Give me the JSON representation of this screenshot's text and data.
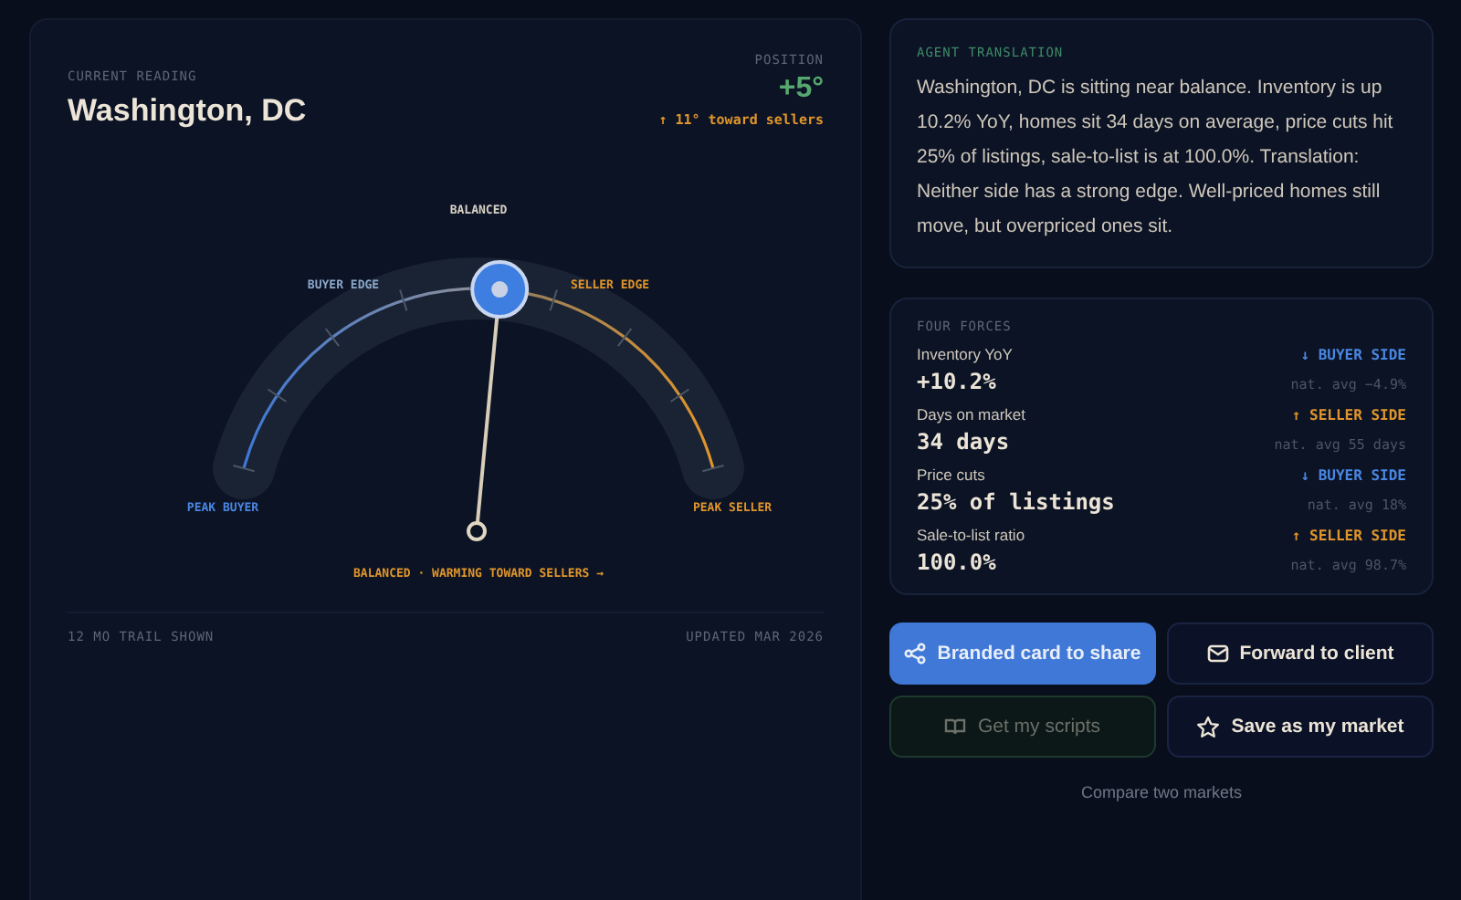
{
  "reading": {
    "label": "CURRENT READING",
    "city": "Washington, DC"
  },
  "position": {
    "label": "POSITION",
    "value": "+5°",
    "trend": "↑ 11° toward sellers"
  },
  "gauge": {
    "top_label": "BALANCED",
    "labels": [
      {
        "text": "BUYER EDGE",
        "kind": "buyer"
      },
      {
        "text": "SELLER EDGE",
        "kind": "seller"
      },
      {
        "text": "PEAK BUYER",
        "kind": "buyer"
      },
      {
        "text": "PEAK SELLER",
        "kind": "seller"
      }
    ],
    "caption": "BALANCED · WARMING TOWARD SELLERS →"
  },
  "footer": {
    "left": "12 MO TRAIL SHOWN",
    "right": "UPDATED MAR 2026"
  },
  "translation": {
    "label": "AGENT TRANSLATION",
    "text": "Washington, DC is sitting near balance. Inventory is up 10.2% YoY, homes sit 34 days on average, price cuts hit 25% of listings, sale-to-list is at 100.0%. Translation: Neither side has a strong edge. Well-priced homes still move, but overpriced ones sit."
  },
  "forces": {
    "label": "FOUR FORCES",
    "items": [
      {
        "name": "Inventory YoY",
        "kind": "buyer",
        "tag": "↓ BUYER SIDE",
        "value": "+10.2%",
        "avg": "nat. avg −4.9%"
      },
      {
        "name": "Days on market",
        "kind": "seller",
        "tag": "↑ SELLER SIDE",
        "value": "34 days",
        "avg": "nat. avg 55 days"
      },
      {
        "name": "Price cuts",
        "kind": "buyer",
        "tag": "↓ BUYER SIDE",
        "value": "25% of listings",
        "avg": "nat. avg 18%"
      },
      {
        "name": "Sale-to-list ratio",
        "kind": "seller",
        "tag": "↑ SELLER SIDE",
        "value": "100.0%",
        "avg": "nat. avg 98.7%"
      }
    ]
  },
  "actions": [
    {
      "label": "Branded card to share",
      "kind": "primary"
    },
    {
      "label": "Forward to client",
      "kind": "dark"
    },
    {
      "label": "Get my scripts",
      "kind": "muted"
    },
    {
      "label": "Save as my market",
      "kind": "dark"
    }
  ],
  "link": "Compare two markets"
}
